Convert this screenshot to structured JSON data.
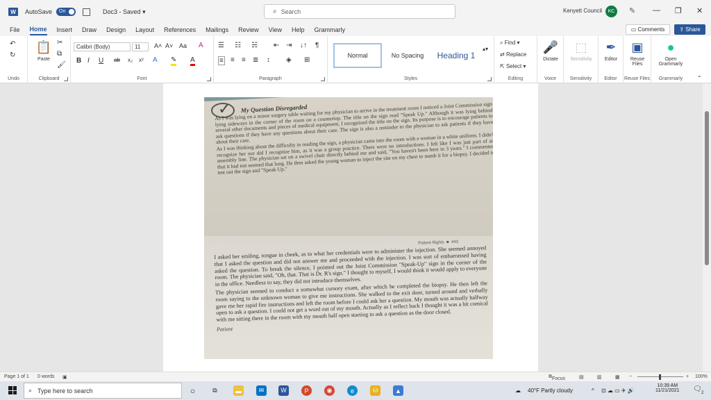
{
  "titlebar": {
    "autosave_label": "AutoSave",
    "autosave_state": "On",
    "doc_title": "Doc3 - Saved",
    "search_placeholder": "Search",
    "user_name": "Kenyett Council",
    "user_initials": "KC"
  },
  "tabs": [
    "File",
    "Home",
    "Insert",
    "Draw",
    "Design",
    "Layout",
    "References",
    "Mailings",
    "Review",
    "View",
    "Help",
    "Grammarly"
  ],
  "active_tab": "Home",
  "buttons": {
    "comments": "Comments",
    "share": "Share"
  },
  "ribbon": {
    "undo_label": "Undo",
    "clipboard_label": "Clipboard",
    "paste_label": "Paste",
    "font_label": "Font",
    "font_name": "Calibri (Body)",
    "font_size": "11",
    "paragraph_label": "Paragraph",
    "styles_label": "Styles",
    "styles": [
      "Normal",
      "No Spacing",
      "Heading 1"
    ],
    "editing_label": "Editing",
    "find": "Find",
    "replace": "Replace",
    "select": "Select",
    "voice_label": "Voice",
    "dictate": "Dictate",
    "sensitivity_label": "Sensitivity",
    "sensitivity": "Sensitivity",
    "editor_label": "Editor",
    "editor": "Editor",
    "reuse_label": "Reuse Files",
    "reuse_line1": "Reuse",
    "reuse_line2": "Files",
    "grammarly_label": "Grammarly",
    "open_line1": "Open",
    "open_line2": "Grammarly"
  },
  "document": {
    "page1_heading": "My Question Disregarded",
    "page1_p1": "As I was lying on a minor surgery table waiting for my physician to arrive in the treatment room I noticed a Joint Commission sign lying sideways in the corner of the room on a countertop. The title on the sign read \"Speak Up.\" Although it was lying behind several other documents and pieces of medical equipment, I recognized the title on the sign. Its purpose is to encourage patients to ask questions if they have any questions about their care. The sign is also a reminder to the physician to ask patients if they have about their care.",
    "page1_p2": "As I was thinking about the difficulty in reading the sign, a physician came into the room with a woman in a white uniform. I didn't recognize her nor did I recognize him, as it was a group practice. There were no introductions. I felt like I was just part of an assembly line. The physician sat on a swivel chair directly behind me and said, \"You haven't been here in 3 years.\" I commented that it had not seemed that long. He then asked the young woman to inject the site on my chest to numb it for a biopsy. I decided to test out the sign and \"Speak Up.\"",
    "page2_header": "Patient Rights",
    "page2_pagenum": "443",
    "page2_p1": "I asked her smiling, tongue in cheek, as to what her credentials were to administer the injection. She seemed annoyed that I asked the question and did not answer me and proceeded with the injection. I was sort of embarrassed having asked the question. To break the silence, I pointed out the Joint Commission \"Speak-Up\" sign in the corner of the room. The physician said, \"Oh, that. That is Dr. R's sign.\" I thought to myself, I would think it would apply to everyone in the office. Needless to say, they did not introduce themselves.",
    "page2_p2": "The physician seemed to conduct a somewhat cursory exam, after which he completed the biopsy. He then left the room saying to the unknown woman to give me instructions. She walked to the exit door, turned around and verbally gave me her rapid fire instructions and left the room before I could ask her a question. My mouth was actually halfway open to ask a question. I could not get a word out of my mouth. Actually as I reflect back I thought it was a bit comical with me sitting there in the room with my mouth half open starting to ask a question as the door closed.",
    "page2_footer": "Patient"
  },
  "statusbar": {
    "page": "Page 1 of 1",
    "words": "0 words",
    "focus": "Focus",
    "zoom": "100%"
  },
  "taskbar": {
    "search_placeholder": "Type here to search",
    "weather": "40°F  Partly cloudy",
    "time": "10:39 AM",
    "date": "11/21/2021",
    "notifications": "2"
  }
}
